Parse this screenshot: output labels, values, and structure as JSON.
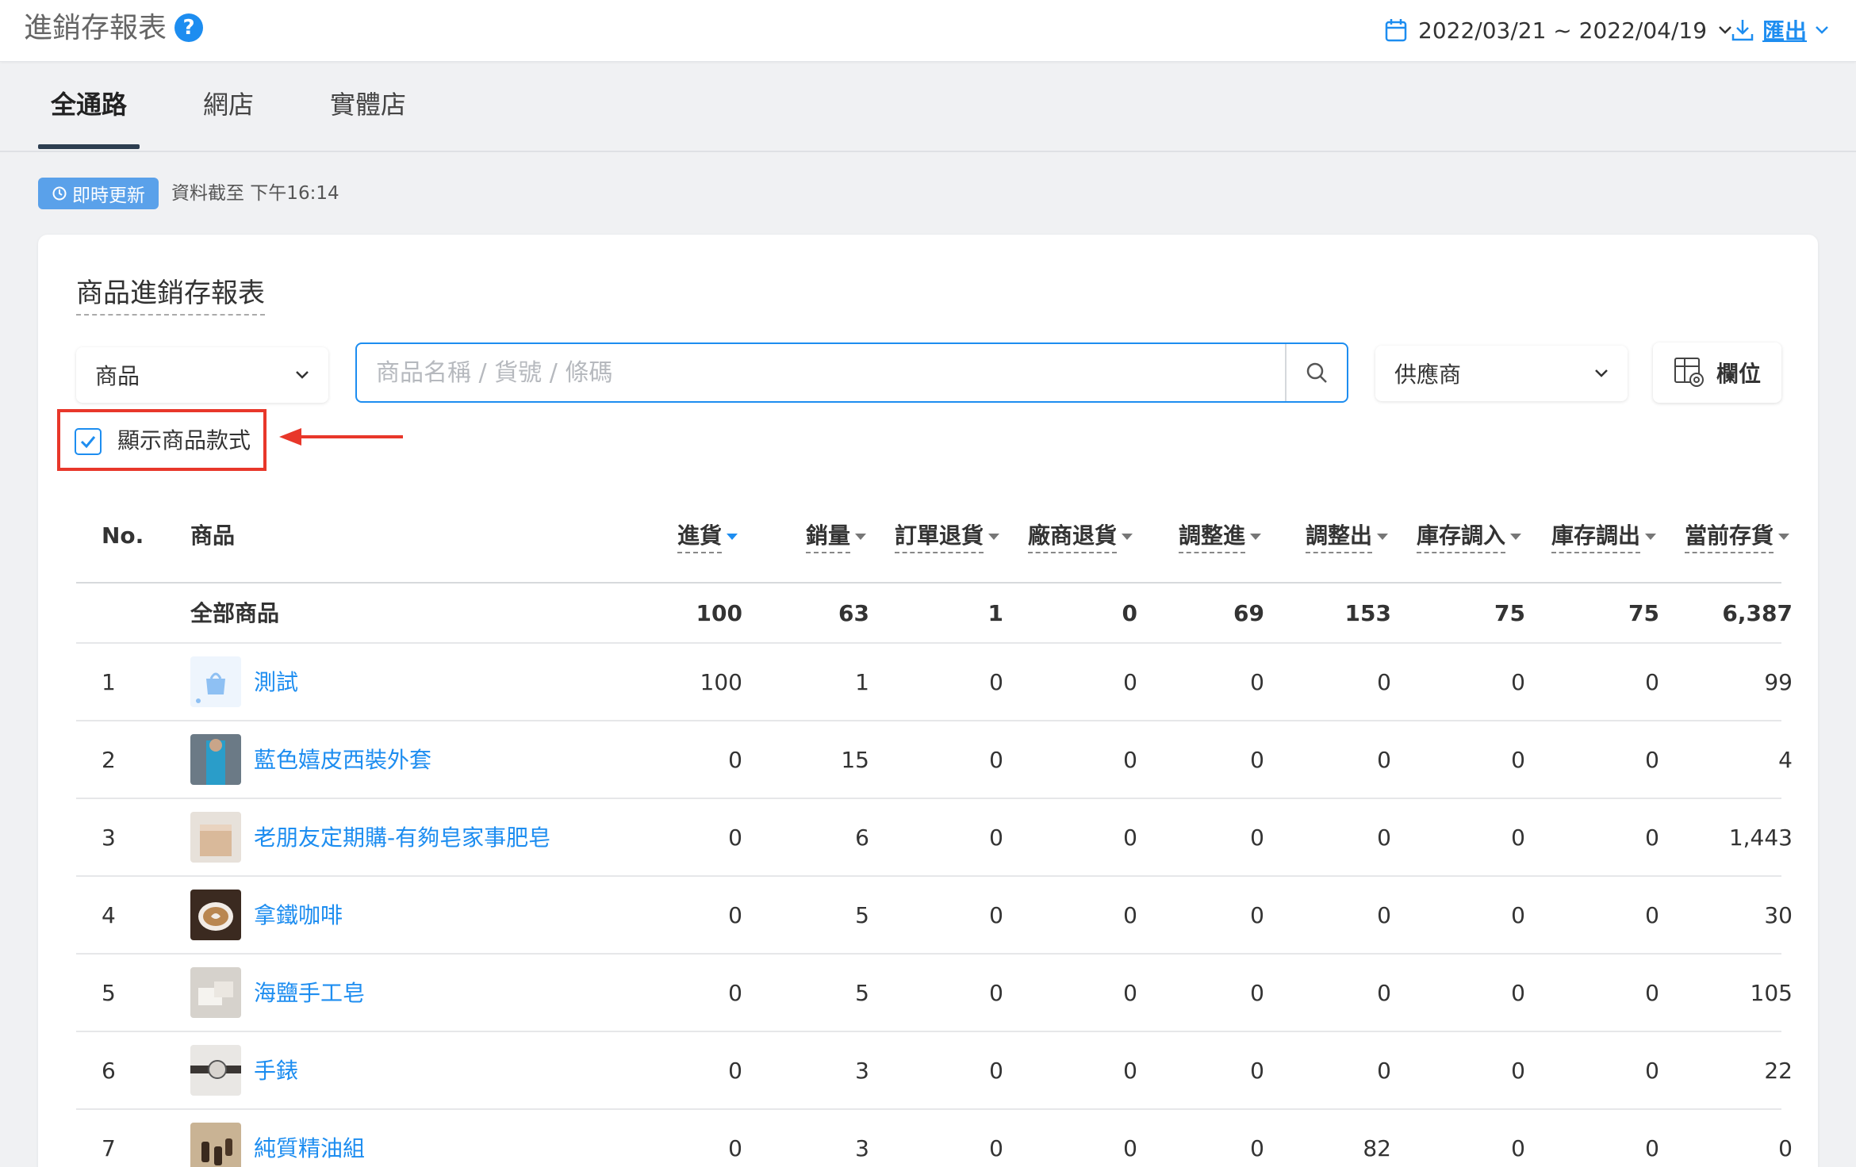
{
  "header": {
    "title": "進銷存報表",
    "help_icon": "question-circle-icon",
    "date_range": "2022/03/21 ~ 2022/04/19",
    "export_label": "匯出"
  },
  "tabs": [
    {
      "label": "全通路",
      "active": true
    },
    {
      "label": "網店",
      "active": false
    },
    {
      "label": "實體店",
      "active": false
    }
  ],
  "status": {
    "live_badge": "即時更新",
    "updated_text": "資料截至 下午16:14"
  },
  "card": {
    "title": "商品進銷存報表",
    "product_select": "商品",
    "search_placeholder": "商品名稱 / 貨號 / 條碼",
    "supplier_select": "供應商",
    "columns_button": "欄位",
    "show_variants_label": "顯示商品款式",
    "show_variants_checked": true
  },
  "table": {
    "columns": [
      "No.",
      "商品",
      "進貨",
      "銷量",
      "訂單退貨",
      "廠商退貨",
      "調整進",
      "調整出",
      "庫存調入",
      "庫存調出",
      "當前存貨"
    ],
    "total": {
      "label": "全部商品",
      "values": [
        "100",
        "63",
        "1",
        "0",
        "69",
        "153",
        "75",
        "75",
        "6,387"
      ]
    },
    "rows": [
      {
        "no": "1",
        "name": "測試",
        "thumb": "bag",
        "values": [
          "100",
          "1",
          "0",
          "0",
          "0",
          "0",
          "0",
          "0",
          "99"
        ]
      },
      {
        "no": "2",
        "name": "藍色嬉皮西裝外套",
        "thumb": "jacket",
        "values": [
          "0",
          "15",
          "0",
          "0",
          "0",
          "0",
          "0",
          "0",
          "4"
        ]
      },
      {
        "no": "3",
        "name": "老朋友定期購-有夠皂家事肥皂",
        "thumb": "soap-box",
        "values": [
          "0",
          "6",
          "0",
          "0",
          "0",
          "0",
          "0",
          "0",
          "1,443"
        ]
      },
      {
        "no": "4",
        "name": "拿鐵咖啡",
        "thumb": "coffee",
        "values": [
          "0",
          "5",
          "0",
          "0",
          "0",
          "0",
          "0",
          "0",
          "30"
        ]
      },
      {
        "no": "5",
        "name": "海鹽手工皂",
        "thumb": "salt-soap",
        "values": [
          "0",
          "5",
          "0",
          "0",
          "0",
          "0",
          "0",
          "0",
          "105"
        ]
      },
      {
        "no": "6",
        "name": "手錶",
        "thumb": "watch",
        "values": [
          "0",
          "3",
          "0",
          "0",
          "0",
          "0",
          "0",
          "0",
          "22"
        ]
      },
      {
        "no": "7",
        "name": "純質精油組",
        "thumb": "oil",
        "values": [
          "0",
          "3",
          "0",
          "0",
          "0",
          "82",
          "0",
          "0",
          "0"
        ]
      }
    ]
  },
  "colors": {
    "accent": "#1d8df0",
    "highlight": "#e8372a",
    "badge": "#5aa1ea"
  }
}
